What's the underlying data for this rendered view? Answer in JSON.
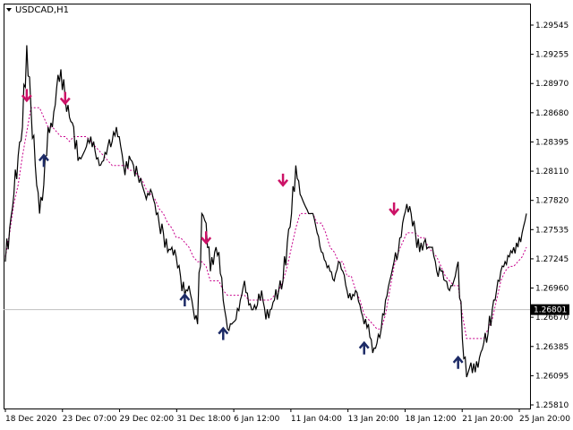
{
  "window": {
    "symbol_label": "USDCAD,H1",
    "dropdown_icon": "triangle-down-icon"
  },
  "colors": {
    "background": "#ffffff",
    "grid": "#c0c0c0",
    "price_line": "#000000",
    "ma_line": "#c8008c",
    "ma_line_up": "#000000",
    "sell_arrow": "#cc1166",
    "buy_arrow": "#1c2a66",
    "current_price_line": "#c0c0c0",
    "current_price_box": "#000000"
  },
  "chart_data": {
    "type": "line",
    "title": "USDCAD,H1",
    "xlabel": "",
    "ylabel": "",
    "ylim": [
      1.2581,
      1.2976
    ],
    "y_ticks": [
      "1.29545",
      "1.29255",
      "1.28970",
      "1.28680",
      "1.28395",
      "1.28110",
      "1.27820",
      "1.27535",
      "1.27245",
      "1.26960",
      "1.26670",
      "1.26385",
      "1.26095",
      "1.25810"
    ],
    "current_price": "1.26801",
    "x_ticks": [
      "18 Dec 2020",
      "23 Dec 07:00",
      "29 Dec 02:00",
      "31 Dec 18:00",
      "6 Jan 12:00",
      "11 Jan 04:00",
      "13 Jan 20:00",
      "18 Jan 12:00",
      "21 Jan 20:00",
      "25 Jan 20:00"
    ],
    "grid": false,
    "series": [
      {
        "values": [
          1.273,
          1.2765,
          1.28,
          1.284,
          1.287,
          1.2955,
          1.289,
          1.283,
          1.278,
          1.281,
          1.287,
          1.287,
          1.291,
          1.293,
          1.29,
          1.288,
          1.287,
          1.2835,
          1.284,
          1.285,
          1.286,
          1.2845,
          1.283,
          1.2835,
          1.285,
          1.2855,
          1.287,
          1.285,
          1.282,
          1.284,
          1.283,
          1.282,
          1.281,
          1.2795,
          1.2805,
          1.279,
          1.277,
          1.276,
          1.274,
          1.2745,
          1.2735,
          1.2715,
          1.2695,
          1.2705,
          1.268,
          1.2665,
          1.278,
          1.277,
          1.272,
          1.274,
          1.274,
          1.269,
          1.266,
          1.2665,
          1.267,
          1.269,
          1.271,
          1.2685,
          1.268,
          1.2685,
          1.27,
          1.267,
          1.268,
          1.269,
          1.27,
          1.271,
          1.275,
          1.278,
          1.283,
          1.28,
          1.279,
          1.278,
          1.278,
          1.276,
          1.274,
          1.273,
          1.272,
          1.271,
          1.273,
          1.272,
          1.27,
          1.269,
          1.27,
          1.2685,
          1.2665,
          1.2665,
          1.2635,
          1.2645,
          1.266,
          1.269,
          1.271,
          1.273,
          1.274,
          1.277,
          1.279,
          1.278,
          1.276,
          1.274,
          1.275,
          1.2745,
          1.2745,
          1.272,
          1.272,
          1.271,
          1.27,
          1.271,
          1.273,
          1.265,
          1.261,
          1.2625,
          1.2615,
          1.263,
          1.2645,
          1.2655,
          1.268,
          1.27,
          1.272,
          1.273,
          1.2735,
          1.2745,
          1.2745,
          1.276,
          1.278
        ]
      },
      {
        "values": [
          1.2735,
          1.276,
          1.279,
          1.281,
          1.284,
          1.2865,
          1.289,
          1.289,
          1.289,
          1.288,
          1.287,
          1.287,
          1.2865,
          1.286,
          1.286,
          1.2855,
          1.286,
          1.286,
          1.286,
          1.286,
          1.2855,
          1.285,
          1.2845,
          1.284,
          1.2835,
          1.283,
          1.283,
          1.283,
          1.283,
          1.2825,
          1.2825,
          1.282,
          1.2815,
          1.2805,
          1.28,
          1.2795,
          1.2785,
          1.278,
          1.277,
          1.2765,
          1.2755,
          1.2755,
          1.275,
          1.2745,
          1.2735,
          1.273,
          1.273,
          1.2725,
          1.271,
          1.271,
          1.271,
          1.27,
          1.2695,
          1.2695,
          1.2695,
          1.2695,
          1.2695,
          1.269,
          1.269,
          1.269,
          1.269,
          1.269,
          1.269,
          1.2695,
          1.27,
          1.271,
          1.2725,
          1.2745,
          1.2765,
          1.278,
          1.278,
          1.278,
          1.278,
          1.277,
          1.277,
          1.276,
          1.2745,
          1.274,
          1.273,
          1.273,
          1.2715,
          1.2715,
          1.27,
          1.269,
          1.2675,
          1.267,
          1.2665,
          1.266,
          1.266,
          1.2675,
          1.27,
          1.2725,
          1.274,
          1.275,
          1.276,
          1.276,
          1.276,
          1.2755,
          1.2755,
          1.2745,
          1.274,
          1.2735,
          1.2725,
          1.2715,
          1.271,
          1.2705,
          1.2705,
          1.2675,
          1.265,
          1.265,
          1.265,
          1.265,
          1.265,
          1.266,
          1.267,
          1.269,
          1.271,
          1.272,
          1.2725,
          1.2725,
          1.273,
          1.2735,
          1.2745
        ]
      }
    ],
    "sell_signals": [
      {
        "x_index": 5,
        "value": 1.2903
      },
      {
        "x_index": 14,
        "value": 1.29
      },
      {
        "x_index": 65,
        "value": 1.2815
      },
      {
        "x_index": 91,
        "value": 1.2785
      },
      {
        "x_index": 47,
        "value": 1.2755
      }
    ],
    "buy_signals": [
      {
        "x_index": 9,
        "value": 1.2835
      },
      {
        "x_index": 42,
        "value": 1.269
      },
      {
        "x_index": 51,
        "value": 1.2655
      },
      {
        "x_index": 84,
        "value": 1.264
      },
      {
        "x_index": 106,
        "value": 1.2625
      }
    ]
  }
}
